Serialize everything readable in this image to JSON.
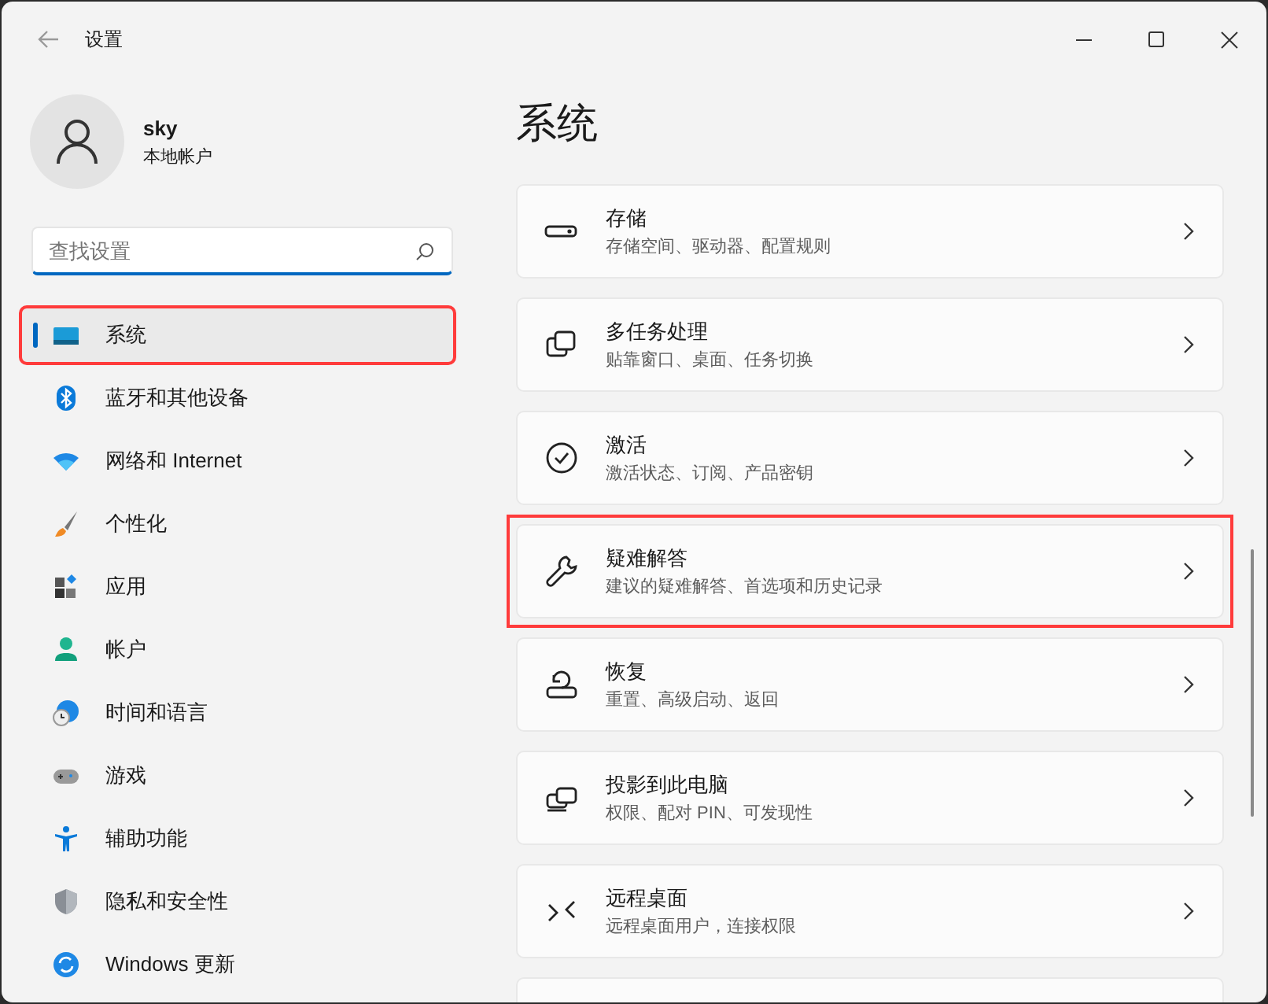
{
  "window": {
    "title": "设置"
  },
  "account": {
    "name": "sky",
    "type": "本地帐户"
  },
  "search": {
    "placeholder": "查找设置"
  },
  "sidebar": {
    "items": [
      {
        "label": "系统",
        "selected": true,
        "highlighted": true
      },
      {
        "label": "蓝牙和其他设备",
        "selected": false,
        "highlighted": false
      },
      {
        "label": "网络和 Internet",
        "selected": false,
        "highlighted": false
      },
      {
        "label": "个性化",
        "selected": false,
        "highlighted": false
      },
      {
        "label": "应用",
        "selected": false,
        "highlighted": false
      },
      {
        "label": "帐户",
        "selected": false,
        "highlighted": false
      },
      {
        "label": "时间和语言",
        "selected": false,
        "highlighted": false
      },
      {
        "label": "游戏",
        "selected": false,
        "highlighted": false
      },
      {
        "label": "辅助功能",
        "selected": false,
        "highlighted": false
      },
      {
        "label": "隐私和安全性",
        "selected": false,
        "highlighted": false
      },
      {
        "label": "Windows 更新",
        "selected": false,
        "highlighted": false
      }
    ]
  },
  "page": {
    "title": "系统",
    "cards": [
      {
        "title": "存储",
        "subtitle": "存储空间、驱动器、配置规则",
        "highlighted": false
      },
      {
        "title": "多任务处理",
        "subtitle": "贴靠窗口、桌面、任务切换",
        "highlighted": false
      },
      {
        "title": "激活",
        "subtitle": "激活状态、订阅、产品密钥",
        "highlighted": false
      },
      {
        "title": "疑难解答",
        "subtitle": "建议的疑难解答、首选项和历史记录",
        "highlighted": true
      },
      {
        "title": "恢复",
        "subtitle": "重置、高级启动、返回",
        "highlighted": false
      },
      {
        "title": "投影到此电脑",
        "subtitle": "权限、配对 PIN、可发现性",
        "highlighted": false
      },
      {
        "title": "远程桌面",
        "subtitle": "远程桌面用户，连接权限",
        "highlighted": false
      }
    ]
  }
}
